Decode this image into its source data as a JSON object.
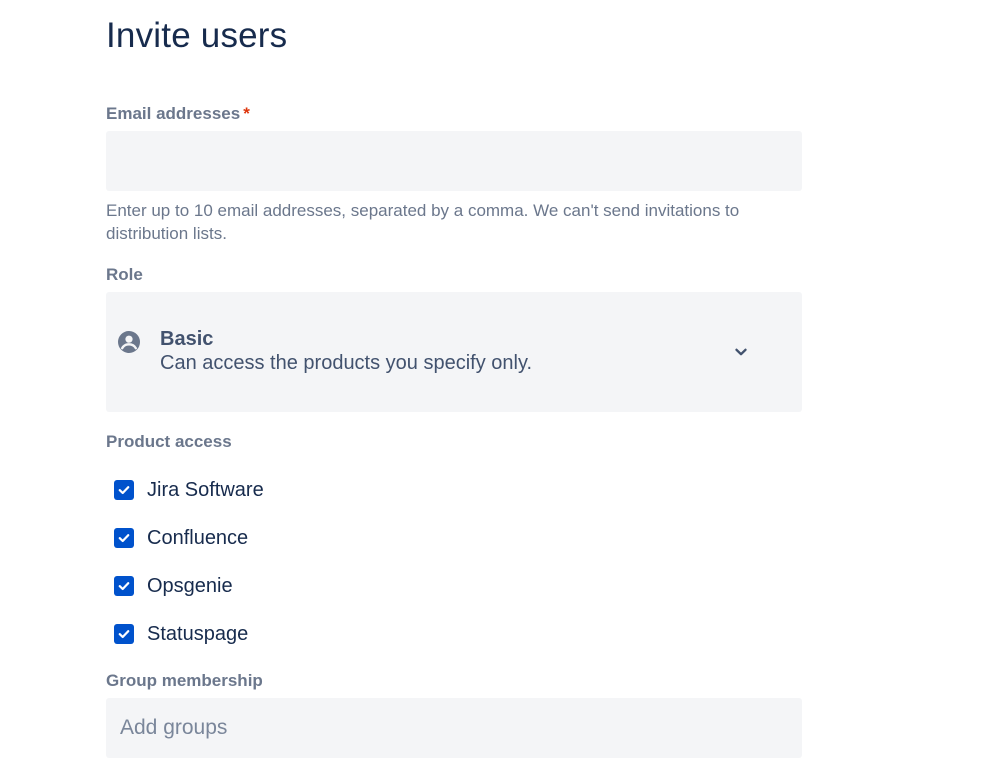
{
  "page": {
    "title": "Invite users"
  },
  "email": {
    "label": "Email addresses",
    "required_marker": "*",
    "value": "",
    "placeholder": "",
    "helper": "Enter up to 10 email addresses, separated by a comma. We can't send invitations to distribution lists."
  },
  "role": {
    "label": "Role",
    "selected_name": "Basic",
    "selected_description": "Can access the products you specify only.",
    "icon": "user-circle-icon",
    "dropdown_icon": "chevron-down-icon"
  },
  "product_access": {
    "label": "Product access",
    "items": [
      {
        "label": "Jira Software",
        "checked": true
      },
      {
        "label": "Confluence",
        "checked": true
      },
      {
        "label": "Opsgenie",
        "checked": true
      },
      {
        "label": "Statuspage",
        "checked": true
      }
    ]
  },
  "groups": {
    "label": "Group membership",
    "placeholder": "Add groups",
    "value": ""
  },
  "colors": {
    "heading": "#172b4d",
    "label": "#6b778c",
    "field_bg": "#f4f5f7",
    "checkbox": "#0052cc",
    "required": "#de350b"
  }
}
